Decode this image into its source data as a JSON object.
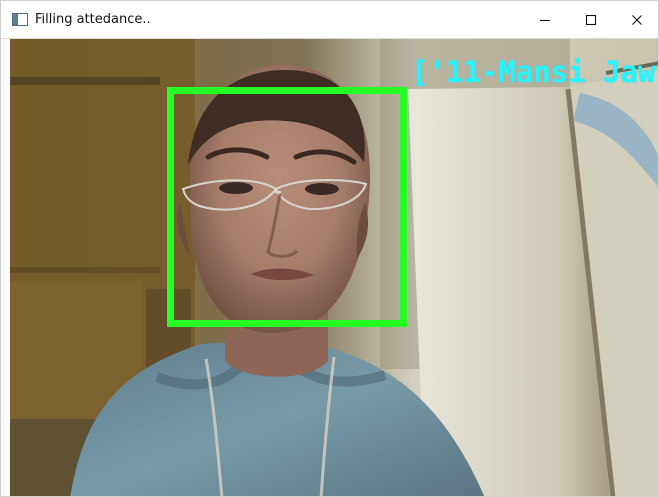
{
  "window": {
    "title": "Filling attedance..",
    "controls": {
      "minimize_icon": "minimize-icon",
      "maximize_icon": "maximize-icon",
      "close_icon": "close-icon"
    }
  },
  "camera": {
    "recognized_label": "['11-Mansi Jaw",
    "detection_box_color": "#24ff24",
    "label_color": "#24f5ff"
  }
}
